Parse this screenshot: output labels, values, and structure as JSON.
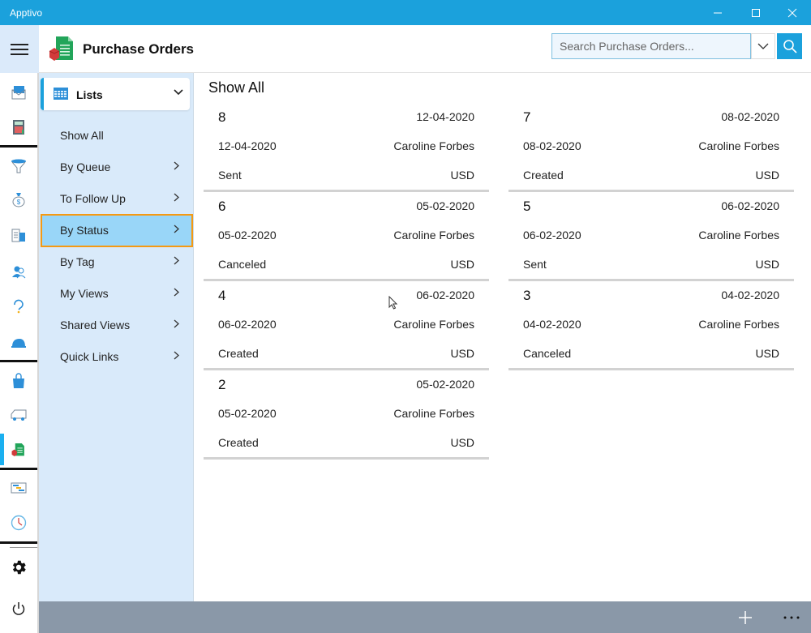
{
  "window": {
    "title": "Apptivo"
  },
  "header": {
    "module_title": "Purchase Orders",
    "search_placeholder": "Search Purchase Orders...",
    "search_value": ""
  },
  "rail": {
    "items": [
      {
        "icon": "email-marketing-icon"
      },
      {
        "icon": "calculator-icon"
      },
      {
        "icon": "funnel-icon"
      },
      {
        "icon": "money-bag-icon"
      },
      {
        "icon": "building-icon"
      },
      {
        "icon": "contacts-icon"
      },
      {
        "icon": "support-headset-icon"
      },
      {
        "icon": "hard-hat-icon"
      },
      {
        "icon": "shopping-bag-icon"
      },
      {
        "icon": "delivery-truck-icon"
      },
      {
        "icon": "purchase-order-icon",
        "active": true
      },
      {
        "icon": "gantt-chart-icon"
      },
      {
        "icon": "clock-icon"
      },
      {
        "icon": "settings-gear-icon"
      },
      {
        "icon": "power-icon"
      }
    ]
  },
  "listpanel": {
    "dropdown_label": "Lists",
    "items": [
      {
        "label": "Show All",
        "has_arrow": false
      },
      {
        "label": "By Queue",
        "has_arrow": true
      },
      {
        "label": "To Follow Up",
        "has_arrow": true
      },
      {
        "label": "By Status",
        "has_arrow": true,
        "selected": true
      },
      {
        "label": "By Tag",
        "has_arrow": true
      },
      {
        "label": "My Views",
        "has_arrow": true
      },
      {
        "label": "Shared Views",
        "has_arrow": true
      },
      {
        "label": "Quick Links",
        "has_arrow": true
      }
    ]
  },
  "content": {
    "title": "Show All",
    "orders": [
      {
        "number": "8",
        "date": "12-04-2020",
        "order_date": "12-04-2020",
        "owner": "Caroline Forbes",
        "status": "Sent",
        "currency": "USD"
      },
      {
        "number": "7",
        "date": "08-02-2020",
        "order_date": "08-02-2020",
        "owner": "Caroline Forbes",
        "status": "Created",
        "currency": "USD"
      },
      {
        "number": "6",
        "date": "05-02-2020",
        "order_date": "05-02-2020",
        "owner": "Caroline Forbes",
        "status": "Canceled",
        "currency": "USD"
      },
      {
        "number": "5",
        "date": "06-02-2020",
        "order_date": "06-02-2020",
        "owner": "Caroline Forbes",
        "status": "Sent",
        "currency": "USD"
      },
      {
        "number": "4",
        "date": "06-02-2020",
        "order_date": "06-02-2020",
        "owner": "Caroline Forbes",
        "status": "Created",
        "currency": "USD"
      },
      {
        "number": "3",
        "date": "04-02-2020",
        "order_date": "04-02-2020",
        "owner": "Caroline Forbes",
        "status": "Canceled",
        "currency": "USD"
      },
      {
        "number": "2",
        "date": "05-02-2020",
        "order_date": "05-02-2020",
        "owner": "Caroline Forbes",
        "status": "Created",
        "currency": "USD"
      }
    ]
  },
  "bottombar": {
    "add_icon": "plus-icon",
    "more_icon": "more-icon"
  },
  "colors": {
    "accent": "#1ba1dc",
    "panel_bg": "#d9eafa",
    "selected_bg": "#99d6f8",
    "selected_outline": "#f59a12",
    "bottombar_bg": "#8a98a8"
  }
}
